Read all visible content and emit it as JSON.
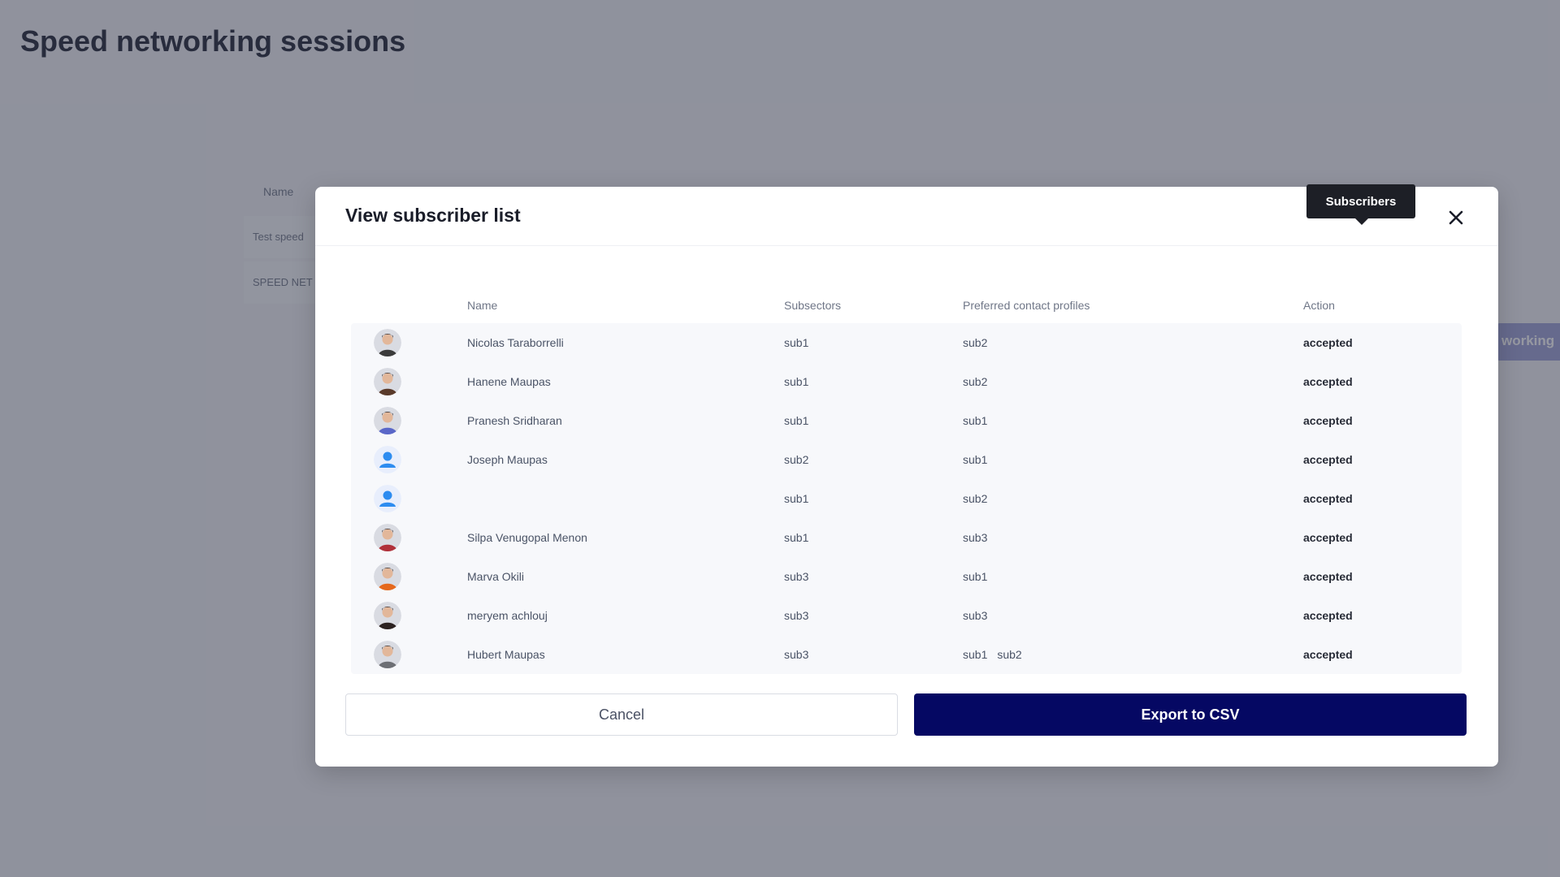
{
  "page": {
    "title": "Speed networking sessions",
    "table_header_name": "Name",
    "rows": [
      "Test speed",
      "SPEED NET"
    ],
    "action_button_label": "working"
  },
  "modal": {
    "title": "View subscriber list",
    "tooltip": "Subscribers",
    "close_icon": "close-icon",
    "columns": {
      "name": "Name",
      "subsectors": "Subsectors",
      "preferred": "Preferred contact profiles",
      "action": "Action"
    },
    "rows": [
      {
        "name": "Nicolas Taraborrelli",
        "subsectors": "sub1",
        "preferred": [
          "sub2"
        ],
        "action": "accepted",
        "avatar": "photo-dark-hair",
        "avatar_color": "#3b3b3b"
      },
      {
        "name": "Hanene Maupas",
        "subsectors": "sub1",
        "preferred": [
          "sub2"
        ],
        "action": "accepted",
        "avatar": "photo-long-hair",
        "avatar_color": "#5a3a2a"
      },
      {
        "name": "Pranesh Sridharan",
        "subsectors": "sub1",
        "preferred": [
          "sub1"
        ],
        "action": "accepted",
        "avatar": "photo-blue-bg",
        "avatar_color": "#5a67c8"
      },
      {
        "name": "Joseph Maupas",
        "subsectors": "sub2",
        "preferred": [
          "sub1"
        ],
        "action": "accepted",
        "avatar": "default-user-icon",
        "avatar_color": "#2d8cf0"
      },
      {
        "name": "",
        "subsectors": "sub1",
        "preferred": [
          "sub2"
        ],
        "action": "accepted",
        "avatar": "default-user-icon",
        "avatar_color": "#2d8cf0"
      },
      {
        "name": "Silpa Venugopal Menon",
        "subsectors": "sub1",
        "preferred": [
          "sub3"
        ],
        "action": "accepted",
        "avatar": "photo-red-top",
        "avatar_color": "#b0303a"
      },
      {
        "name": "Marva Okili",
        "subsectors": "sub3",
        "preferred": [
          "sub1"
        ],
        "action": "accepted",
        "avatar": "photo-orange-top",
        "avatar_color": "#e5681c"
      },
      {
        "name": "meryem achlouj",
        "subsectors": "sub3",
        "preferred": [
          "sub3"
        ],
        "action": "accepted",
        "avatar": "photo-dark-hair-long",
        "avatar_color": "#2b2120"
      },
      {
        "name": "Hubert Maupas",
        "subsectors": "sub3",
        "preferred": [
          "sub1",
          "sub2"
        ],
        "action": "accepted",
        "avatar": "photo-grey-hair",
        "avatar_color": "#6d6f74"
      }
    ],
    "cancel_label": "Cancel",
    "export_label": "Export to CSV"
  },
  "colors": {
    "primary": "#050863",
    "overlay": "rgba(35,40,58,0.48)",
    "tooltip_bg": "#1d1f26"
  }
}
